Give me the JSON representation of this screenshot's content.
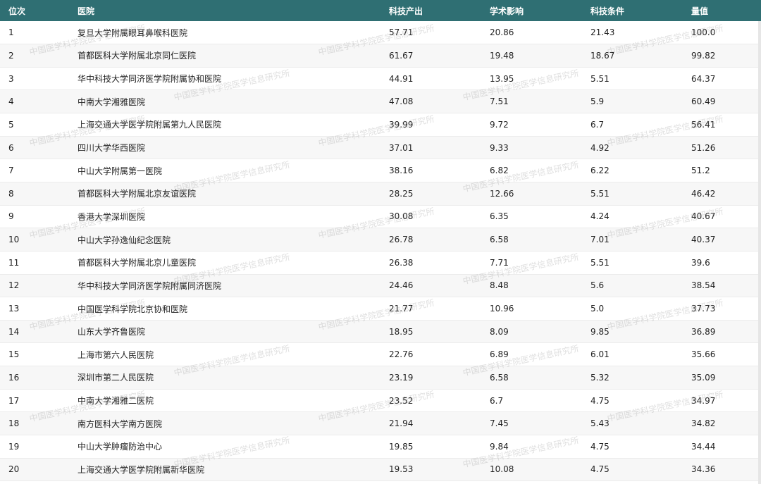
{
  "table": {
    "headers": [
      "位次",
      "医院",
      "科技产出",
      "学术影响",
      "科技条件",
      "量值"
    ],
    "rows": [
      [
        "1",
        "复旦大学附属眼耳鼻喉科医院",
        "57.71",
        "20.86",
        "21.43",
        "100.0"
      ],
      [
        "2",
        "首都医科大学附属北京同仁医院",
        "61.67",
        "19.48",
        "18.67",
        "99.82"
      ],
      [
        "3",
        "华中科技大学同济医学院附属协和医院",
        "44.91",
        "13.95",
        "5.51",
        "64.37"
      ],
      [
        "4",
        "中南大学湘雅医院",
        "47.08",
        "7.51",
        "5.9",
        "60.49"
      ],
      [
        "5",
        "上海交通大学医学院附属第九人民医院",
        "39.99",
        "9.72",
        "6.7",
        "56.41"
      ],
      [
        "6",
        "四川大学华西医院",
        "37.01",
        "9.33",
        "4.92",
        "51.26"
      ],
      [
        "7",
        "中山大学附属第一医院",
        "38.16",
        "6.82",
        "6.22",
        "51.2"
      ],
      [
        "8",
        "首都医科大学附属北京友谊医院",
        "28.25",
        "12.66",
        "5.51",
        "46.42"
      ],
      [
        "9",
        "香港大学深圳医院",
        "30.08",
        "6.35",
        "4.24",
        "40.67"
      ],
      [
        "10",
        "中山大学孙逸仙纪念医院",
        "26.78",
        "6.58",
        "7.01",
        "40.37"
      ],
      [
        "11",
        "首都医科大学附属北京儿童医院",
        "26.38",
        "7.71",
        "5.51",
        "39.6"
      ],
      [
        "12",
        "华中科技大学同济医学院附属同济医院",
        "24.46",
        "8.48",
        "5.6",
        "38.54"
      ],
      [
        "13",
        "中国医学科学院北京协和医院",
        "21.77",
        "10.96",
        "5.0",
        "37.73"
      ],
      [
        "14",
        "山东大学齐鲁医院",
        "18.95",
        "8.09",
        "9.85",
        "36.89"
      ],
      [
        "15",
        "上海市第六人民医院",
        "22.76",
        "6.89",
        "6.01",
        "35.66"
      ],
      [
        "16",
        "深圳市第二人民医院",
        "23.19",
        "6.58",
        "5.32",
        "35.09"
      ],
      [
        "17",
        "中南大学湘雅二医院",
        "23.52",
        "6.7",
        "4.75",
        "34.97"
      ],
      [
        "18",
        "南方医科大学南方医院",
        "21.94",
        "7.45",
        "5.43",
        "34.82"
      ],
      [
        "19",
        "中山大学肿瘤防治中心",
        "19.85",
        "9.84",
        "4.75",
        "34.44"
      ],
      [
        "20",
        "上海交通大学医学院附属新华医院",
        "19.53",
        "10.08",
        "4.75",
        "34.36"
      ]
    ]
  },
  "watermark_text": "中国医学科学院医学信息研究所",
  "colors": {
    "header_bg": "#2f6f73",
    "header_text": "#ffffff",
    "row_alt_bg": "#f7f7f7"
  }
}
